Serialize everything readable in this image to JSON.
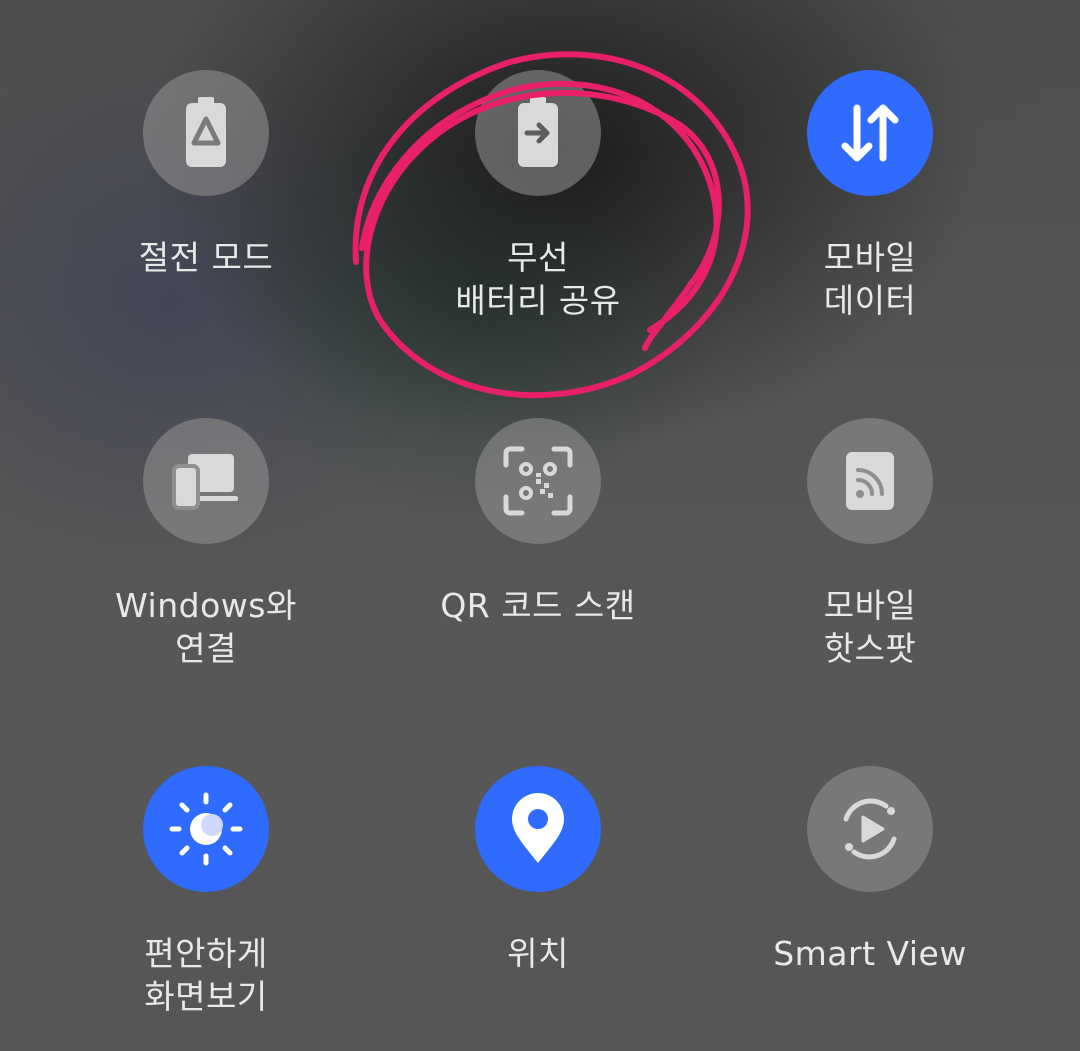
{
  "quick_settings": {
    "tiles": [
      {
        "label": "절전 모드",
        "icon": "battery-saver-icon",
        "active": false
      },
      {
        "label": "무선\n배터리 공유",
        "icon": "wireless-powershare-icon",
        "active": false
      },
      {
        "label": "모바일\n데이터",
        "icon": "mobile-data-icon",
        "active": true
      },
      {
        "label": "Windows와\n연결",
        "icon": "link-to-windows-icon",
        "active": false
      },
      {
        "label": "QR 코드 스캔",
        "icon": "qr-scan-icon",
        "active": false
      },
      {
        "label": "모바일\n핫스팟",
        "icon": "mobile-hotspot-icon",
        "active": false
      },
      {
        "label": "편안하게\n화면보기",
        "icon": "eye-comfort-icon",
        "active": true
      },
      {
        "label": "위치",
        "icon": "location-icon",
        "active": true
      },
      {
        "label": "Smart View",
        "icon": "smart-view-icon",
        "active": false
      }
    ]
  },
  "colors": {
    "active_tile": "#2f6bff",
    "inactive_tile": "#8f8f8f",
    "annotation_circle": "#e8206a"
  }
}
